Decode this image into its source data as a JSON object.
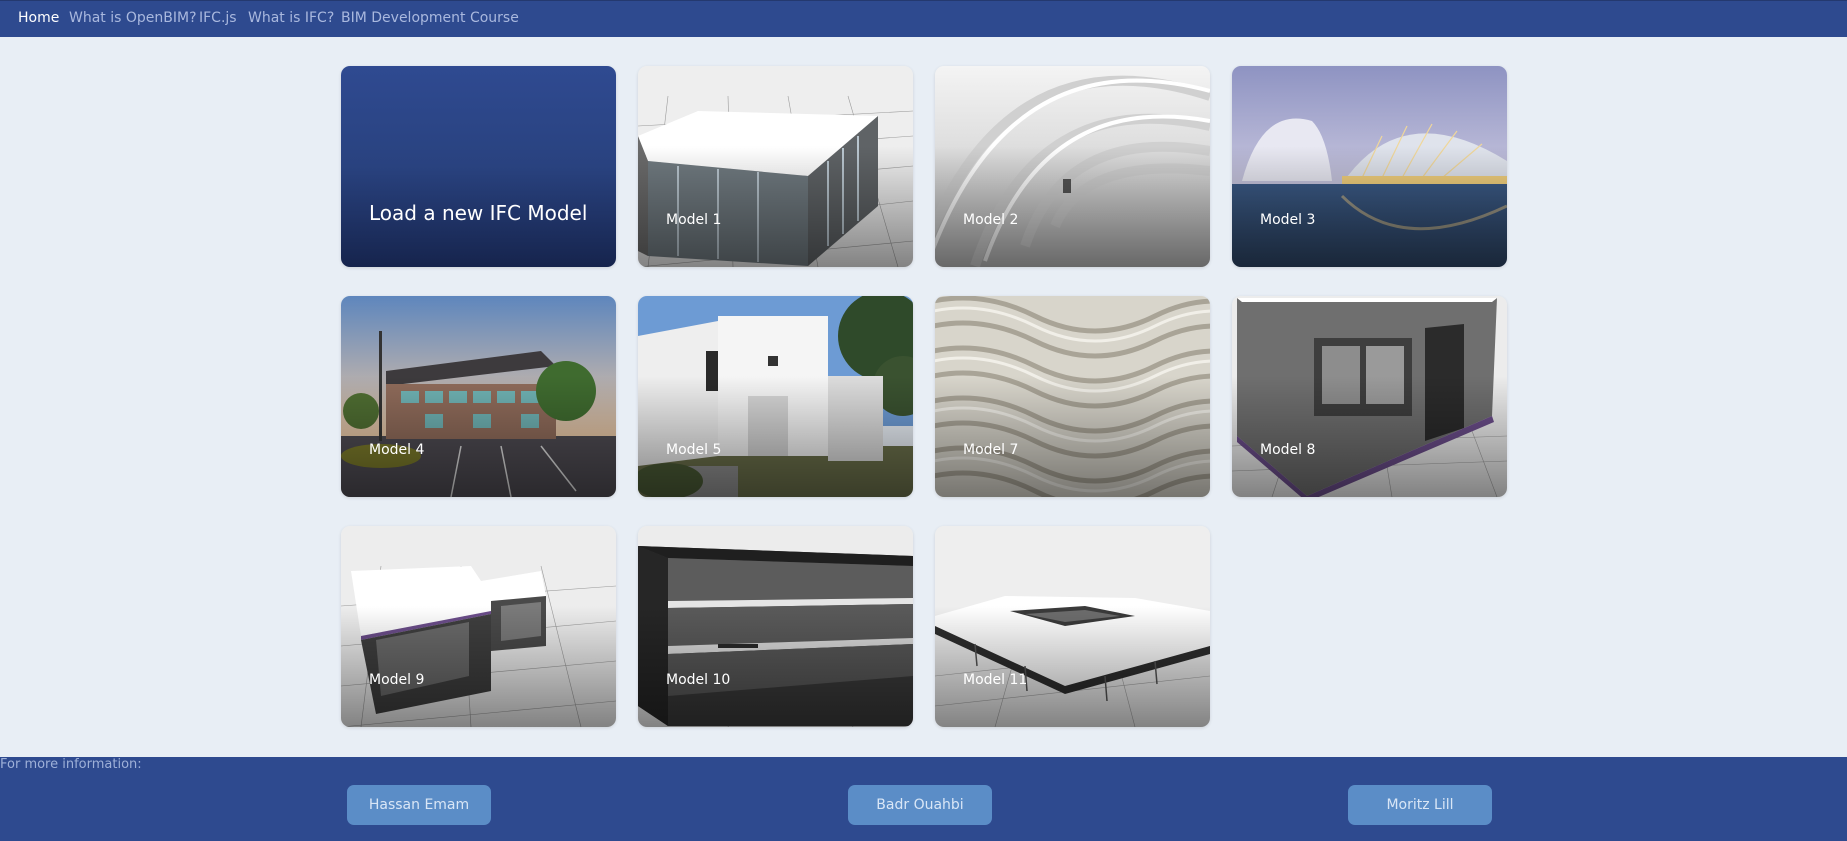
{
  "nav": {
    "items": [
      {
        "label": "Home",
        "active": true
      },
      {
        "label": "What is OpenBIM?"
      },
      {
        "label": "IFC.js"
      },
      {
        "label": "What is IFC?"
      },
      {
        "label": "BIM Development Course"
      }
    ]
  },
  "gallery": {
    "load_card": {
      "label": "Load a new IFC Model"
    },
    "models": [
      {
        "label": "Model 1"
      },
      {
        "label": "Model 2"
      },
      {
        "label": "Model 3"
      },
      {
        "label": "Model 4"
      },
      {
        "label": "Model 5"
      },
      {
        "label": "Model 7"
      },
      {
        "label": "Model 8"
      },
      {
        "label": "Model 9"
      },
      {
        "label": "Model 10"
      },
      {
        "label": "Model 11"
      }
    ]
  },
  "footer": {
    "info": "For more information:",
    "contacts": [
      {
        "label": "Hassan Emam"
      },
      {
        "label": "Badr Ouahbi"
      },
      {
        "label": "Moritz Lill"
      }
    ]
  },
  "colors": {
    "header_bg": "#2e4a8f",
    "page_bg": "#e8eef5",
    "button_bg": "#5b8dc7"
  }
}
